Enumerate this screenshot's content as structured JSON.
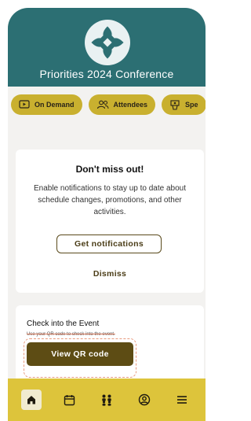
{
  "header": {
    "title": "Priorities 2024 Conference",
    "background_color": "#2c6f73",
    "logo_icon": "lotus-logo-icon"
  },
  "chips": [
    {
      "label": "On Demand",
      "icon": "play-screen-icon"
    },
    {
      "label": "Attendees",
      "icon": "people-icon"
    },
    {
      "label": "Spe",
      "icon": "speaker-podium-icon"
    }
  ],
  "notification_card": {
    "title": "Don't miss out!",
    "body": "Enable notifications to stay up to date about schedule changes, promotions, and other activities.",
    "primary_button": "Get notifications",
    "secondary_button": "Dismiss"
  },
  "checkin_card": {
    "title": "Check into the Event",
    "subtitle": "Use your QR code to check into the event.",
    "button": "View QR code"
  },
  "tabbar": {
    "background_color": "#ddc43b",
    "items": [
      {
        "icon": "home-icon",
        "active": true
      },
      {
        "icon": "calendar-icon",
        "active": false
      },
      {
        "icon": "attendees-icon",
        "active": false
      },
      {
        "icon": "profile-icon",
        "active": false
      },
      {
        "icon": "menu-icon",
        "active": false
      }
    ]
  }
}
